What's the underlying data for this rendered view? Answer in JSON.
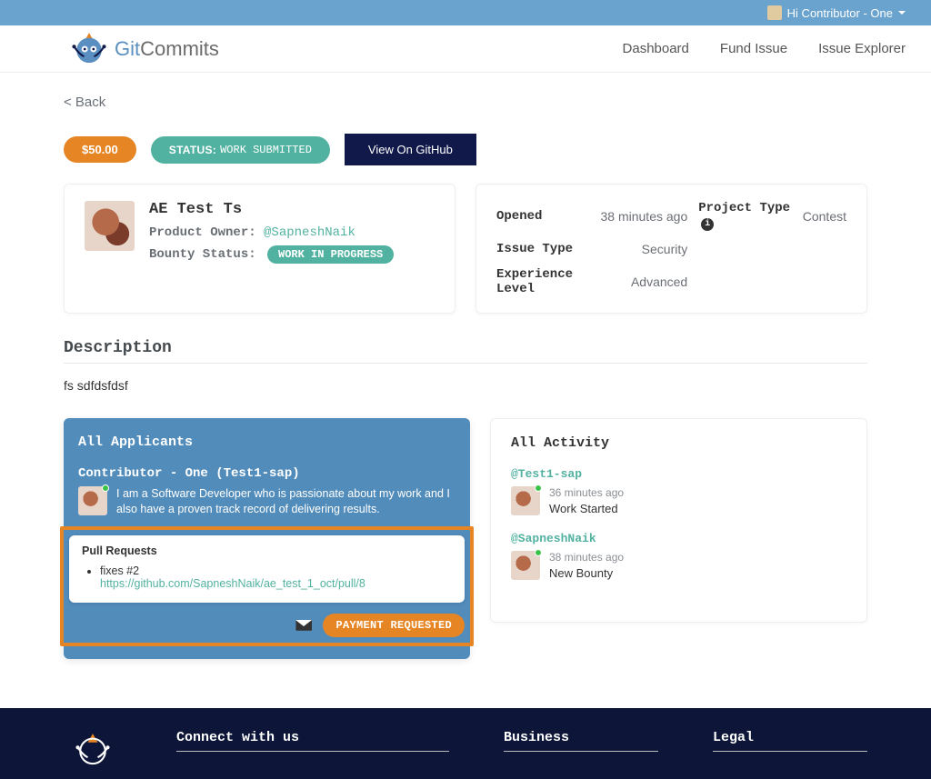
{
  "topbar": {
    "greeting": "Hi Contributor - One"
  },
  "brand": {
    "part1": "Git",
    "part2": "Commits"
  },
  "nav": {
    "dashboard": "Dashboard",
    "fund": "Fund Issue",
    "explorer": "Issue Explorer"
  },
  "back": "< Back",
  "badges": {
    "amount": "$50.00",
    "status_label": "STATUS:",
    "status_value": "WORK SUBMITTED",
    "github_btn": "View On GitHub"
  },
  "issue": {
    "title": "AE Test Ts",
    "owner_label": "Product Owner:",
    "owner_handle": "@SapneshNaik",
    "bounty_label": "Bounty Status:",
    "bounty_value": "WORK IN PROGRESS"
  },
  "info": {
    "opened_label": "Opened",
    "opened_value": "38 minutes ago",
    "project_type_label": "Project Type",
    "project_type_value": "Contest",
    "issue_type_label": "Issue Type",
    "issue_type_value": "Security",
    "exp_label": "Experience Level",
    "exp_value": "Advanced"
  },
  "description": {
    "heading": "Description",
    "body": "fs sdfdsfdsf"
  },
  "applicants": {
    "heading": "All Applicants",
    "name": "Contributor - One (Test1-sap)",
    "bio": "I am a Software Developer who is passionate about my work and I also have a proven track record of delivering results.",
    "pr_heading": "Pull Requests",
    "pr_text": "fixes #2",
    "pr_url": "https://github.com/SapneshNaik/ae_test_1_oct/pull/8",
    "payment_btn": "PAYMENT REQUESTED"
  },
  "activity": {
    "heading": "All Activity",
    "items": [
      {
        "user": "@Test1-sap",
        "time": "36 minutes ago",
        "text": "Work Started"
      },
      {
        "user": "@SapneshNaik",
        "time": "38 minutes ago",
        "text": "New Bounty"
      }
    ]
  },
  "footer": {
    "connect": "Connect with us",
    "business": "Business",
    "legal": "Legal"
  }
}
